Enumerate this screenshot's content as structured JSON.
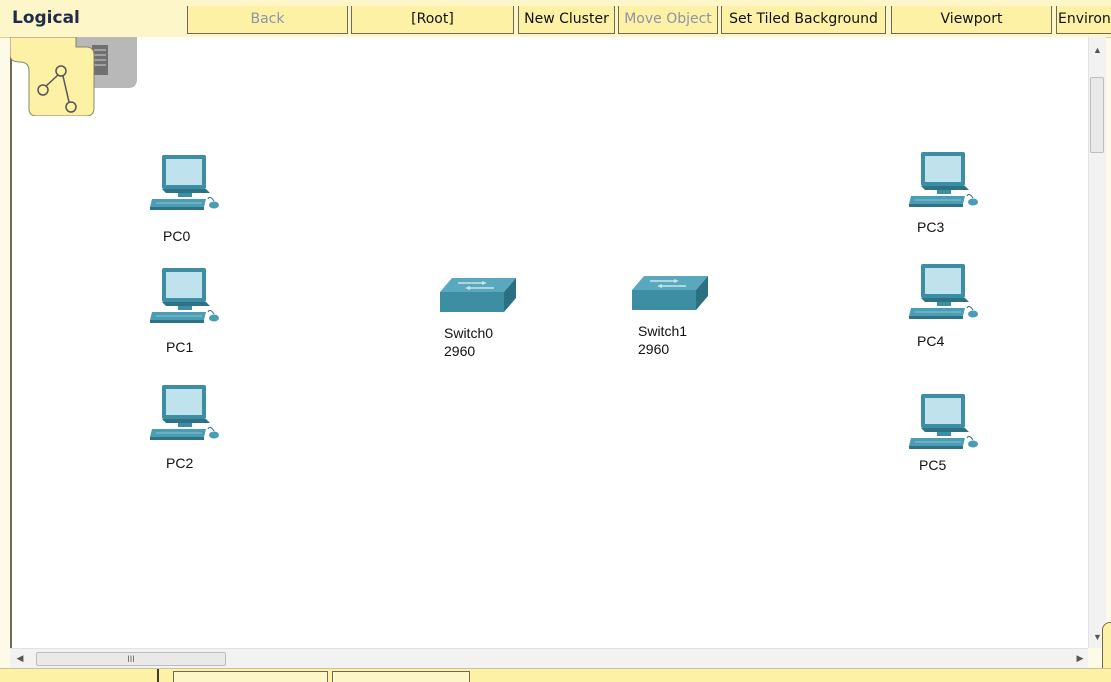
{
  "toolbar": {
    "mode_label": "Logical",
    "buttons": [
      {
        "label": "Back",
        "disabled": true
      },
      {
        "label": "[Root]",
        "disabled": false
      },
      {
        "label": "New Cluster",
        "disabled": false
      },
      {
        "label": "Move Object",
        "disabled": true
      },
      {
        "label": "Set Tiled Background",
        "disabled": false
      },
      {
        "label": "Viewport",
        "disabled": false
      },
      {
        "label": "Environ",
        "disabled": false
      }
    ]
  },
  "devices": {
    "pc0": {
      "name": "PC0",
      "icon": "pc-icon"
    },
    "pc1": {
      "name": "PC1",
      "icon": "pc-icon"
    },
    "pc2": {
      "name": "PC2",
      "icon": "pc-icon"
    },
    "pc3": {
      "name": "PC3",
      "icon": "pc-icon"
    },
    "pc4": {
      "name": "PC4",
      "icon": "pc-icon"
    },
    "pc5": {
      "name": "PC5",
      "icon": "pc-icon"
    },
    "switch0": {
      "name": "Switch0",
      "model": "2960",
      "icon": "switch-icon"
    },
    "switch1": {
      "name": "Switch1",
      "model": "2960",
      "icon": "switch-icon"
    }
  },
  "scrollbars": {
    "horizontal_grip": "III"
  },
  "colors": {
    "toolbar_bg": "#fdf6c9",
    "button_bg": "#fdf1a6",
    "disabled_text": "#8f93a8",
    "device_teal": "#4a9db3"
  }
}
